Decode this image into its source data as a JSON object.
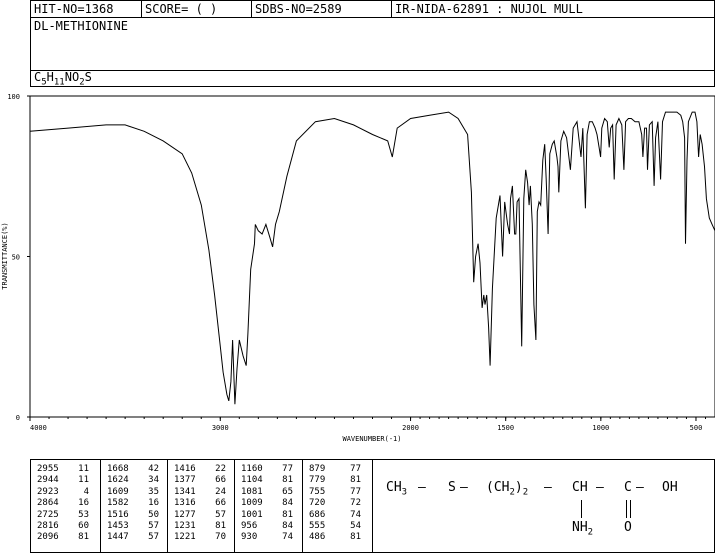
{
  "header": {
    "hit_no": "HIT-NO=1368",
    "score": "SCORE=  (   )",
    "sdbs_no": "SDBS-NO=2589",
    "ir_method": "IR-NIDA-62891 : NUJOL MULL"
  },
  "compound_name": "DL-METHIONINE",
  "formula": {
    "c": "C",
    "c_n": "5",
    "h": "H",
    "h_n": "11",
    "n": "N",
    "o": "O",
    "o_n": "2",
    "s": "S"
  },
  "structure": {
    "ch3": "CH",
    "ch3_sub": "3",
    "s": "S",
    "chain": "(CH",
    "chain_sub": "2",
    "chain_close": ")",
    "chain_n": "2",
    "ch": "CH",
    "c": "C",
    "oh": "OH",
    "nh2": "NH",
    "nh2_sub": "2",
    "o": "O"
  },
  "chart_data": {
    "type": "line",
    "xlabel": "WAVENUMBER(-1)",
    "ylabel": "TRANSMITTANCE(%)",
    "xlim": [
      4000,
      400
    ],
    "ylim": [
      0,
      100
    ],
    "x_ticks": [
      "4000",
      "3000",
      "2000",
      "1500",
      "1000",
      "500"
    ],
    "x_tick_values": [
      4000,
      3000,
      2000,
      1500,
      1000,
      500
    ],
    "y_ticks": [
      "0",
      "50",
      "100"
    ],
    "y_tick_values": [
      0,
      50,
      100
    ],
    "series": [
      {
        "points": [
          [
            4000,
            89
          ],
          [
            3800,
            90
          ],
          [
            3600,
            91
          ],
          [
            3500,
            91
          ],
          [
            3400,
            89
          ],
          [
            3300,
            86
          ],
          [
            3200,
            82
          ],
          [
            3150,
            76
          ],
          [
            3100,
            66
          ],
          [
            3060,
            52
          ],
          [
            3030,
            38
          ],
          [
            3000,
            22
          ],
          [
            2985,
            14
          ],
          [
            2965,
            7
          ],
          [
            2955,
            5
          ],
          [
            2944,
            11
          ],
          [
            2935,
            24
          ],
          [
            2923,
            4
          ],
          [
            2912,
            15
          ],
          [
            2900,
            24
          ],
          [
            2880,
            19
          ],
          [
            2864,
            16
          ],
          [
            2855,
            26
          ],
          [
            2840,
            46
          ],
          [
            2820,
            54
          ],
          [
            2816,
            60
          ],
          [
            2800,
            58
          ],
          [
            2780,
            57
          ],
          [
            2760,
            60
          ],
          [
            2740,
            56
          ],
          [
            2725,
            53
          ],
          [
            2710,
            60
          ],
          [
            2690,
            64
          ],
          [
            2650,
            75
          ],
          [
            2600,
            86
          ],
          [
            2500,
            92
          ],
          [
            2400,
            93
          ],
          [
            2300,
            91
          ],
          [
            2200,
            88
          ],
          [
            2120,
            86
          ],
          [
            2096,
            81
          ],
          [
            2070,
            90
          ],
          [
            2000,
            93
          ],
          [
            1900,
            94
          ],
          [
            1800,
            95
          ],
          [
            1750,
            93
          ],
          [
            1700,
            88
          ],
          [
            1680,
            70
          ],
          [
            1668,
            42
          ],
          [
            1658,
            50
          ],
          [
            1645,
            54
          ],
          [
            1635,
            48
          ],
          [
            1624,
            34
          ],
          [
            1615,
            38
          ],
          [
            1609,
            35
          ],
          [
            1600,
            38
          ],
          [
            1590,
            28
          ],
          [
            1582,
            16
          ],
          [
            1570,
            40
          ],
          [
            1550,
            62
          ],
          [
            1530,
            69
          ],
          [
            1516,
            50
          ],
          [
            1505,
            67
          ],
          [
            1490,
            60
          ],
          [
            1480,
            57
          ],
          [
            1475,
            68
          ],
          [
            1465,
            72
          ],
          [
            1453,
            57
          ],
          [
            1447,
            57
          ],
          [
            1440,
            67
          ],
          [
            1430,
            68
          ],
          [
            1416,
            22
          ],
          [
            1405,
            68
          ],
          [
            1395,
            77
          ],
          [
            1385,
            73
          ],
          [
            1377,
            66
          ],
          [
            1370,
            72
          ],
          [
            1360,
            60
          ],
          [
            1352,
            35
          ],
          [
            1341,
            24
          ],
          [
            1334,
            64
          ],
          [
            1325,
            67
          ],
          [
            1316,
            66
          ],
          [
            1305,
            80
          ],
          [
            1295,
            85
          ],
          [
            1287,
            74
          ],
          [
            1277,
            57
          ],
          [
            1268,
            82
          ],
          [
            1255,
            85
          ],
          [
            1245,
            86
          ],
          [
            1231,
            81
          ],
          [
            1225,
            78
          ],
          [
            1221,
            70
          ],
          [
            1210,
            86
          ],
          [
            1195,
            89
          ],
          [
            1180,
            87
          ],
          [
            1160,
            77
          ],
          [
            1145,
            90
          ],
          [
            1125,
            92
          ],
          [
            1104,
            81
          ],
          [
            1095,
            90
          ],
          [
            1081,
            65
          ],
          [
            1072,
            88
          ],
          [
            1060,
            92
          ],
          [
            1045,
            92
          ],
          [
            1030,
            90
          ],
          [
            1020,
            88
          ],
          [
            1009,
            84
          ],
          [
            1001,
            81
          ],
          [
            995,
            90
          ],
          [
            980,
            93
          ],
          [
            966,
            92
          ],
          [
            956,
            84
          ],
          [
            948,
            90
          ],
          [
            938,
            91
          ],
          [
            930,
            74
          ],
          [
            920,
            91
          ],
          [
            905,
            93
          ],
          [
            890,
            91
          ],
          [
            879,
            77
          ],
          [
            870,
            92
          ],
          [
            855,
            93
          ],
          [
            840,
            93
          ],
          [
            820,
            92
          ],
          [
            800,
            92
          ],
          [
            785,
            88
          ],
          [
            779,
            81
          ],
          [
            770,
            90
          ],
          [
            760,
            90
          ],
          [
            755,
            77
          ],
          [
            745,
            91
          ],
          [
            730,
            92
          ],
          [
            720,
            72
          ],
          [
            712,
            87
          ],
          [
            700,
            92
          ],
          [
            686,
            74
          ],
          [
            676,
            92
          ],
          [
            660,
            95
          ],
          [
            640,
            95
          ],
          [
            620,
            95
          ],
          [
            600,
            95
          ],
          [
            580,
            94
          ],
          [
            570,
            92
          ],
          [
            560,
            87
          ],
          [
            555,
            54
          ],
          [
            547,
            80
          ],
          [
            540,
            92
          ],
          [
            520,
            95
          ],
          [
            505,
            95
          ],
          [
            495,
            92
          ],
          [
            486,
            81
          ],
          [
            478,
            88
          ],
          [
            468,
            85
          ],
          [
            455,
            78
          ],
          [
            445,
            68
          ],
          [
            430,
            62
          ],
          [
            415,
            60
          ],
          [
            400,
            58
          ]
        ]
      }
    ],
    "peak_table": [
      [
        [
          "2955",
          "11"
        ],
        [
          "2944",
          "11"
        ],
        [
          "2923",
          "4"
        ],
        [
          "2864",
          "16"
        ],
        [
          "2725",
          "53"
        ],
        [
          "2816",
          "60"
        ],
        [
          "2096",
          "81"
        ]
      ],
      [
        [
          "1668",
          "42"
        ],
        [
          "1624",
          "34"
        ],
        [
          "1609",
          "35"
        ],
        [
          "1582",
          "16"
        ],
        [
          "1516",
          "50"
        ],
        [
          "1453",
          "57"
        ],
        [
          "1447",
          "57"
        ]
      ],
      [
        [
          "1416",
          "22"
        ],
        [
          "1377",
          "66"
        ],
        [
          "1341",
          "24"
        ],
        [
          "1316",
          "66"
        ],
        [
          "1277",
          "57"
        ],
        [
          "1231",
          "81"
        ],
        [
          "1221",
          "70"
        ]
      ],
      [
        [
          "1160",
          "77"
        ],
        [
          "1104",
          "81"
        ],
        [
          "1081",
          "65"
        ],
        [
          "1009",
          "84"
        ],
        [
          "1001",
          "81"
        ],
        [
          "956",
          "84"
        ],
        [
          "930",
          "74"
        ]
      ],
      [
        [
          "879",
          "77"
        ],
        [
          "779",
          "81"
        ],
        [
          "755",
          "77"
        ],
        [
          "720",
          "72"
        ],
        [
          "686",
          "74"
        ],
        [
          "555",
          "54"
        ],
        [
          "486",
          "81"
        ]
      ]
    ]
  }
}
